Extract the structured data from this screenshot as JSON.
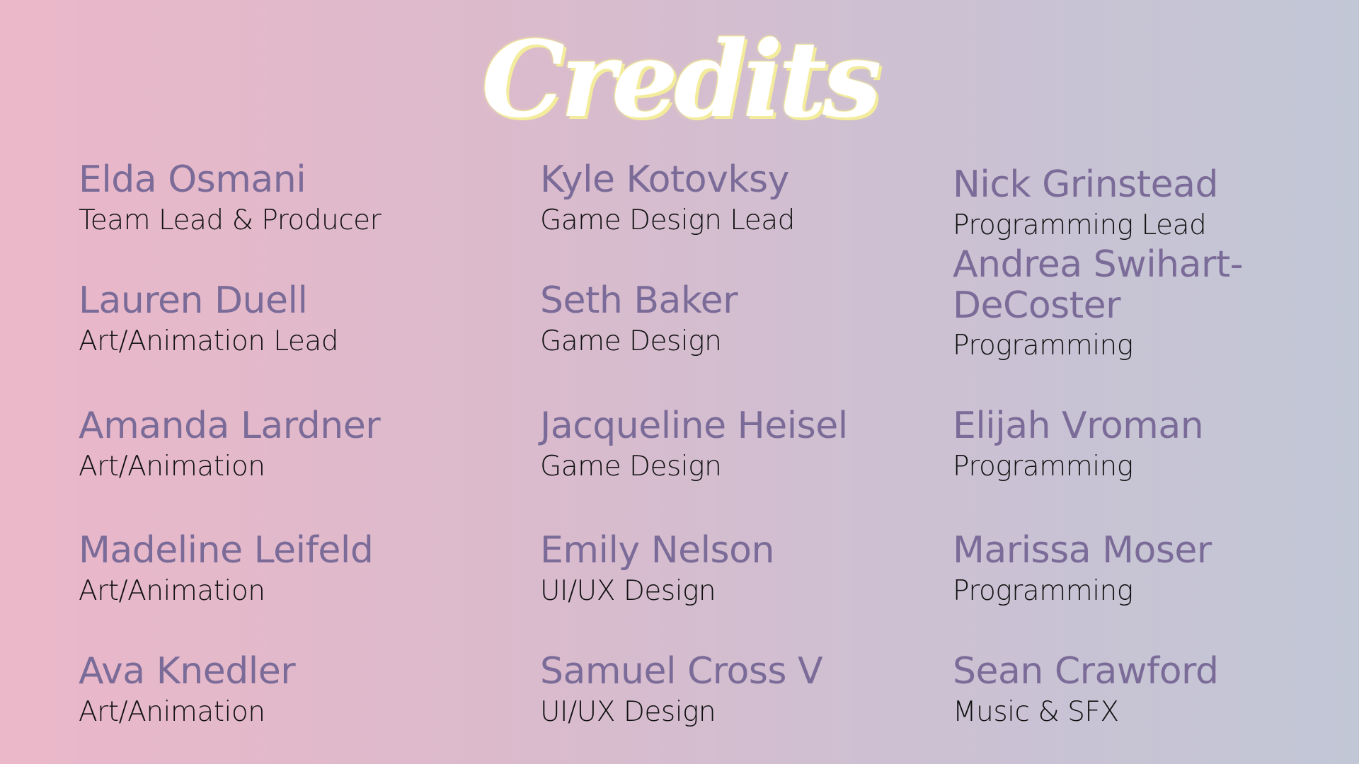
{
  "title": "Credits",
  "credits": [
    {
      "name": "Elda Osmani",
      "role": "Team Lead & Producer"
    },
    {
      "name": "Lauren Duell",
      "role": "Art/Animation Lead"
    },
    {
      "name": "Amanda Lardner",
      "role": "Art/Animation"
    },
    {
      "name": "Madeline Leifeld",
      "role": "Art/Animation"
    },
    {
      "name": "Ava Knedler",
      "role": "Art/Animation"
    },
    {
      "name": "Kyle Kotovksy",
      "role": "Game Design Lead"
    },
    {
      "name": "Seth Baker",
      "role": "Game Design"
    },
    {
      "name": "Jacqueline Heisel",
      "role": "Game Design"
    },
    {
      "name": "Emily Nelson",
      "role": "UI/UX Design"
    },
    {
      "name": "Samuel Cross V",
      "role": "UI/UX Design"
    },
    {
      "name": "Nick Grinstead",
      "role": "Programming Lead"
    },
    {
      "name": "Andrea Swihart-DeCoster",
      "role": "Programming"
    },
    {
      "name": "Elijah Vroman",
      "role": "Programming"
    },
    {
      "name": "Marissa Moser",
      "role": "Programming"
    },
    {
      "name": "Sean Crawford",
      "role": "Music & SFX"
    }
  ],
  "colors": {
    "name": "#7b6b98",
    "role": "#111111",
    "title": "#ffffff",
    "title_glow": "#f3ec9c",
    "background_left": "#ebb8c9",
    "background_right": "#c2c7d6"
  }
}
